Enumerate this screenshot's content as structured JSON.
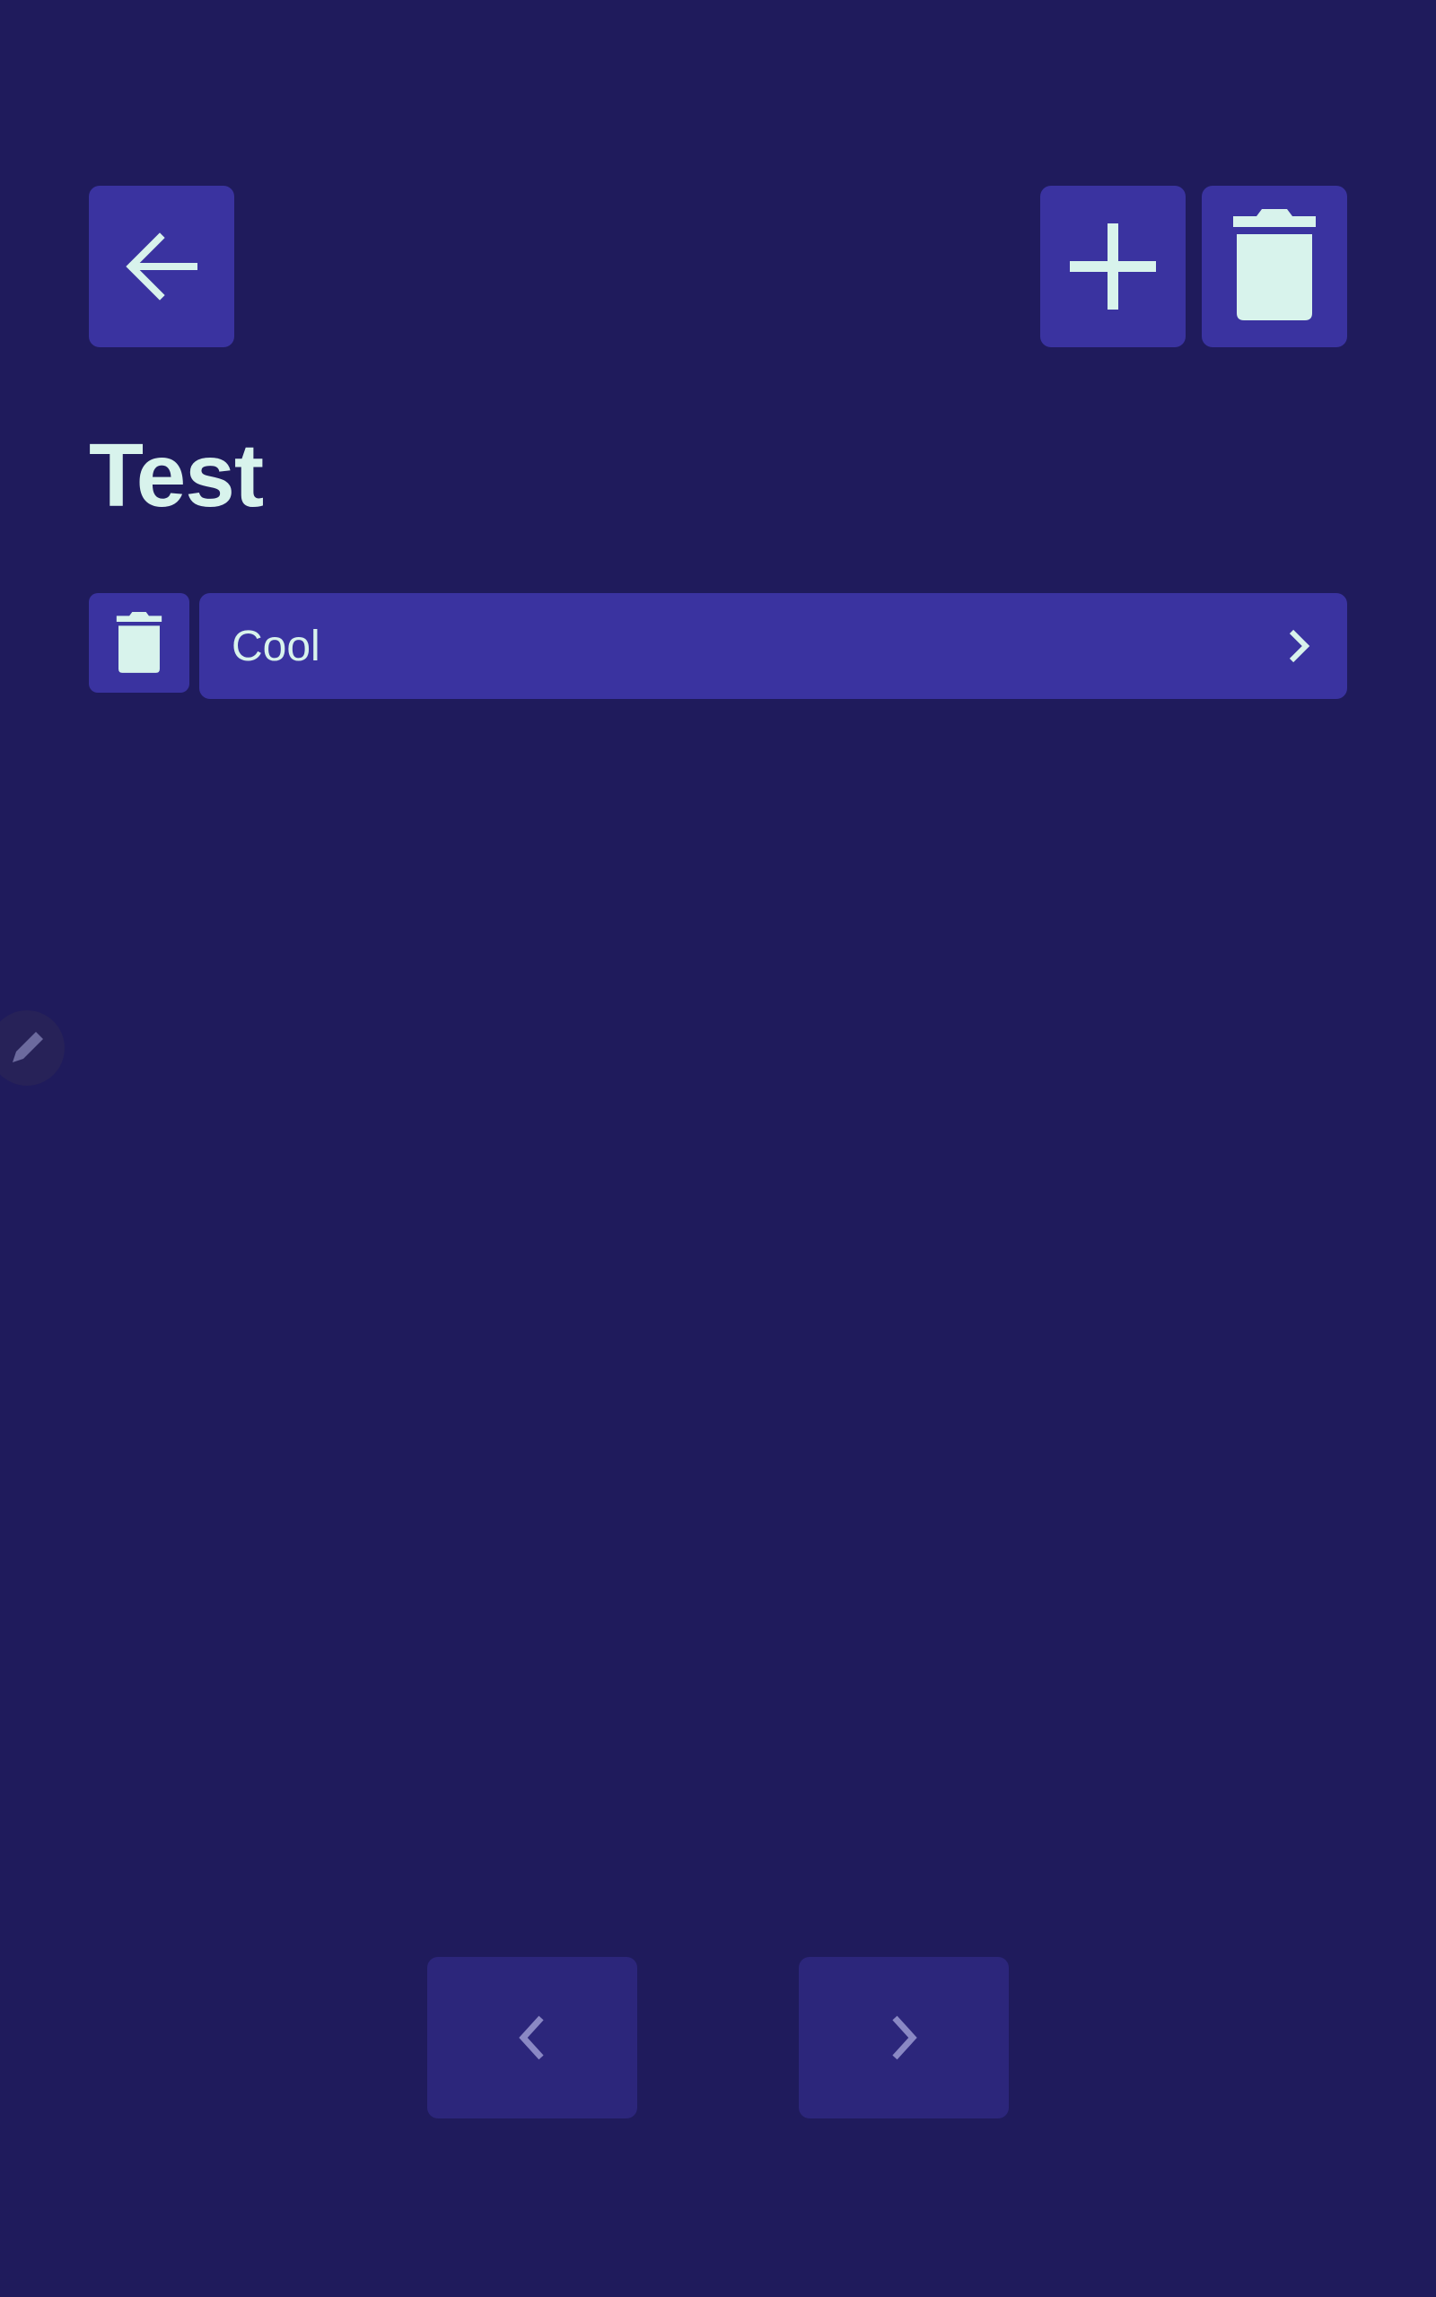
{
  "header": {
    "back_icon": "arrow-left-icon",
    "add_icon": "plus-icon",
    "delete_all_icon": "trash-icon"
  },
  "page": {
    "title": "Test"
  },
  "list": {
    "items": [
      {
        "label": "Cool",
        "delete_icon": "trash-icon",
        "open_icon": "chevron-right-icon"
      }
    ]
  },
  "fab": {
    "icon": "pencil-icon"
  },
  "pagination": {
    "prev_icon": "chevron-left-icon",
    "next_icon": "chevron-right-icon"
  },
  "colors": {
    "background": "#1f1b5c",
    "button": "#3a33a0",
    "pager_button": "#2c267b",
    "foreground": "#d8f3ec"
  }
}
